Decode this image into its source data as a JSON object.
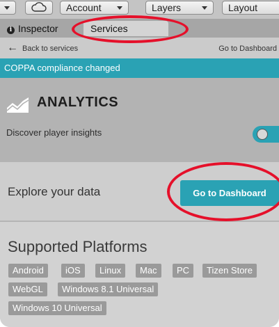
{
  "toolbar": {
    "cloud_icon": "cloud-icon",
    "account_label": "Account",
    "layers_label": "Layers",
    "layout_label": "Layout"
  },
  "tabs": {
    "inspector_label": "Inspector",
    "services_label": "Services"
  },
  "nav": {
    "back_label": "Back to services",
    "dashboard_label": "Go to Dashboard"
  },
  "banner": {
    "text": "COPPA compliance changed"
  },
  "analytics": {
    "title": "ANALYTICS",
    "description": "Discover player insights",
    "enabled": true
  },
  "explore": {
    "label": "Explore your data",
    "button_label": "Go to Dashboard"
  },
  "platforms": {
    "title": "Supported Platforms",
    "items": [
      "Android",
      "iOS",
      "Linux",
      "Mac",
      "PC",
      "Tizen Store",
      "WebGL",
      "Windows 8.1 Universal",
      "Windows 10 Universal"
    ]
  },
  "colors": {
    "accent": "#2aa2b4",
    "annotation": "#e5102a"
  }
}
